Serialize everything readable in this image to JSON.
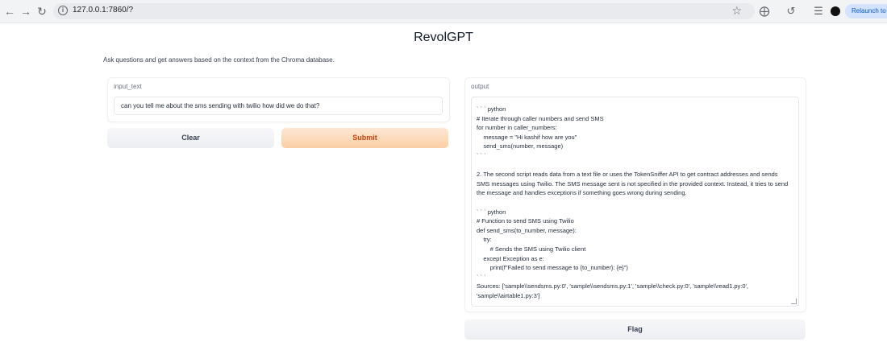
{
  "browser": {
    "url": "127.0.0.1:7860/?",
    "relaunch_label": "Relaunch to up"
  },
  "app": {
    "title": "RevolGPT",
    "description": "Ask questions and get answers based on the context from the Chroma database."
  },
  "input": {
    "label": "input_text",
    "value": "can you tell me about the sms sending with twilio how did we do that?"
  },
  "buttons": {
    "clear": "Clear",
    "submit": "Submit",
    "flag": "Flag"
  },
  "output": {
    "label": "output",
    "lines": [
      "` ` ` python",
      "# Iterate through caller numbers and send SMS",
      "for number in caller_numbers:",
      "    message = \"Hi kashif how are you\"",
      "    send_sms(number, message)",
      "` ` `",
      "",
      "2. The second script reads data from a text file or uses the TokenSniffer API to get contract addresses and sends",
      "SMS messages using Twilio. The SMS message sent is not specified in the provided context. Instead, it tries to send",
      "the message and handles exceptions if something goes wrong during sending.",
      "",
      "` ` ` python",
      "# Function to send SMS using Twilio",
      "def send_sms(to_number, message):",
      "    try:",
      "        # Sends the SMS using Twilio client",
      "    except Exception as e:",
      "        print(f\"Failed to send message to {to_number}: {e}\")",
      "` ` `",
      "Sources: ['sample\\\\sendsms.py:0', 'sample\\\\sendsms.py:1', 'sample\\\\check.py:0', 'sample\\\\read1.py:0',",
      "'sample\\\\airtable1.py:3']"
    ]
  }
}
